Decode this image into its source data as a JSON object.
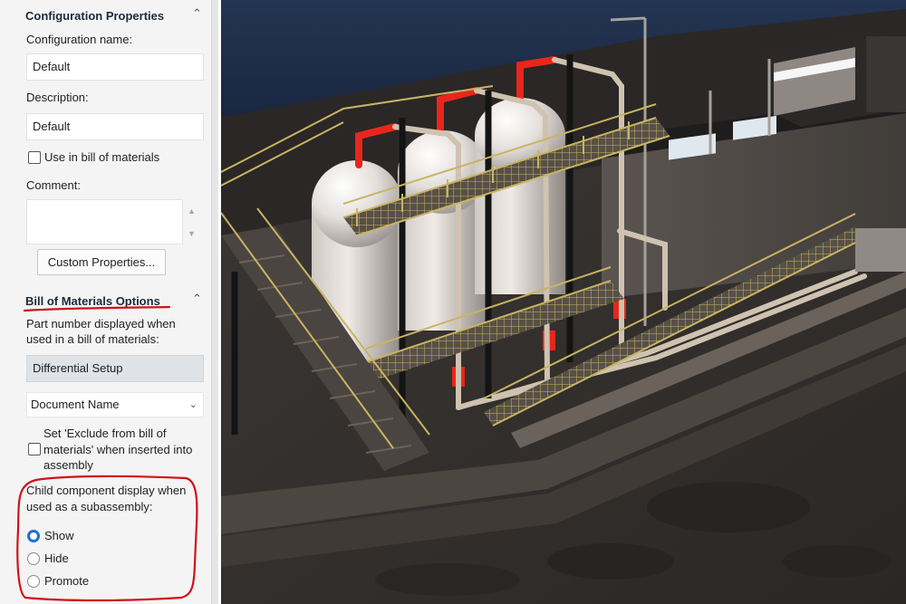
{
  "config_section": {
    "title": "Configuration Properties",
    "name_label": "Configuration name:",
    "name_value": "Default",
    "description_label": "Description:",
    "description_value": "Default",
    "use_in_bom_label": "Use in bill of materials",
    "use_in_bom_checked": false,
    "comment_label": "Comment:",
    "comment_value": "",
    "custom_properties_button": "Custom Properties..."
  },
  "bom_section": {
    "title": "Bill of Materials Options",
    "part_number_label_line1": "Part number displayed when",
    "part_number_label_line2": "used in a bill of materials:",
    "part_number_value": "Differential Setup",
    "document_name_option": "Document Name",
    "exclude_label_line1": "Set 'Exclude from bill of",
    "exclude_label_line2": "materials' when inserted into",
    "exclude_label_line3": "assembly",
    "exclude_checked": false,
    "child_display_line1": "Child component display when",
    "child_display_line2": "used as a subassembly:",
    "options": [
      {
        "label": "Show",
        "selected": true
      },
      {
        "label": "Hide",
        "selected": false
      },
      {
        "label": "Promote",
        "selected": false
      }
    ]
  },
  "icons": {
    "collapse": "chevron-up-icon",
    "dropdown": "chevron-down-icon",
    "scroll_up": "scroll-up-icon",
    "scroll_down": "scroll-down-icon"
  },
  "colors": {
    "annotation_red": "#d0121a",
    "radio_selected": "#1e6fd8",
    "pipe_red": "#e8261c",
    "railing_yellow": "#c8b462"
  }
}
